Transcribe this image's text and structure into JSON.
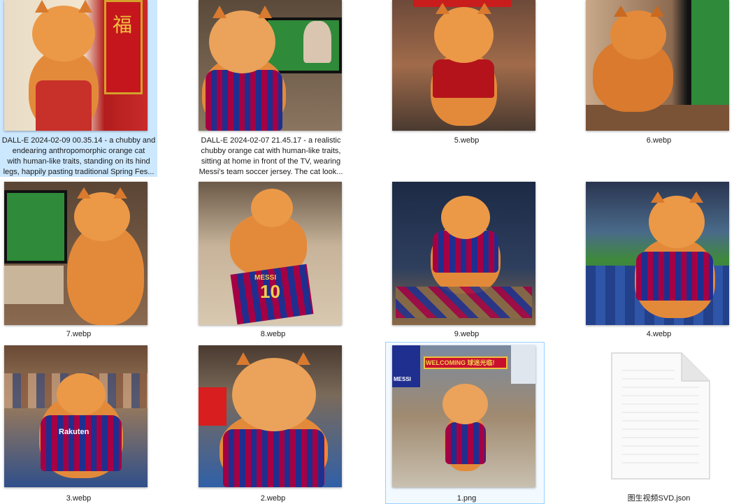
{
  "files": [
    {
      "id": "f1",
      "label_lines": [
        "DALL-E 2024-02-09 00.35.14 - a chubby and",
        "endearing anthropomorphic orange cat",
        "with human-like traits, standing on its hind",
        "legs, happily pasting traditional Spring Fes..."
      ],
      "selected": true
    },
    {
      "id": "f2",
      "label_lines": [
        "DALL-E 2024-02-07 21.45.17 - a realistic",
        "chubby orange cat with human-like traits,",
        "sitting at home in front of the TV, wearing",
        "Messi's team soccer jersey. The cat look..."
      ]
    },
    {
      "id": "f3",
      "label": "5.webp"
    },
    {
      "id": "f4",
      "label": "6.webp"
    },
    {
      "id": "f5",
      "label": "7.webp"
    },
    {
      "id": "f6",
      "label": "8.webp"
    },
    {
      "id": "f7",
      "label": "9.webp"
    },
    {
      "id": "f8",
      "label": "4.webp"
    },
    {
      "id": "f9",
      "label": "3.webp"
    },
    {
      "id": "f10",
      "label": "2.webp"
    },
    {
      "id": "f11",
      "label": "1.png",
      "hover": true
    },
    {
      "id": "f12",
      "label": "图生视频SVD.json",
      "icon": "json-file-icon"
    }
  ],
  "thumb_text": {
    "f1_couplet": "福",
    "f6_shirt_name": "MESSI",
    "f6_shirt_number": "10",
    "f9_sponsor": "Rakuten",
    "f11_banner": "WELCOMING 球迷光临!",
    "f11_poster": "MESSI"
  },
  "colors": {
    "selection": "#cce8ff",
    "hover_border": "#99d1ff",
    "barca_red": "#a50044",
    "barca_blue": "#1f2f8f",
    "cat_orange": "#e08a3c"
  }
}
